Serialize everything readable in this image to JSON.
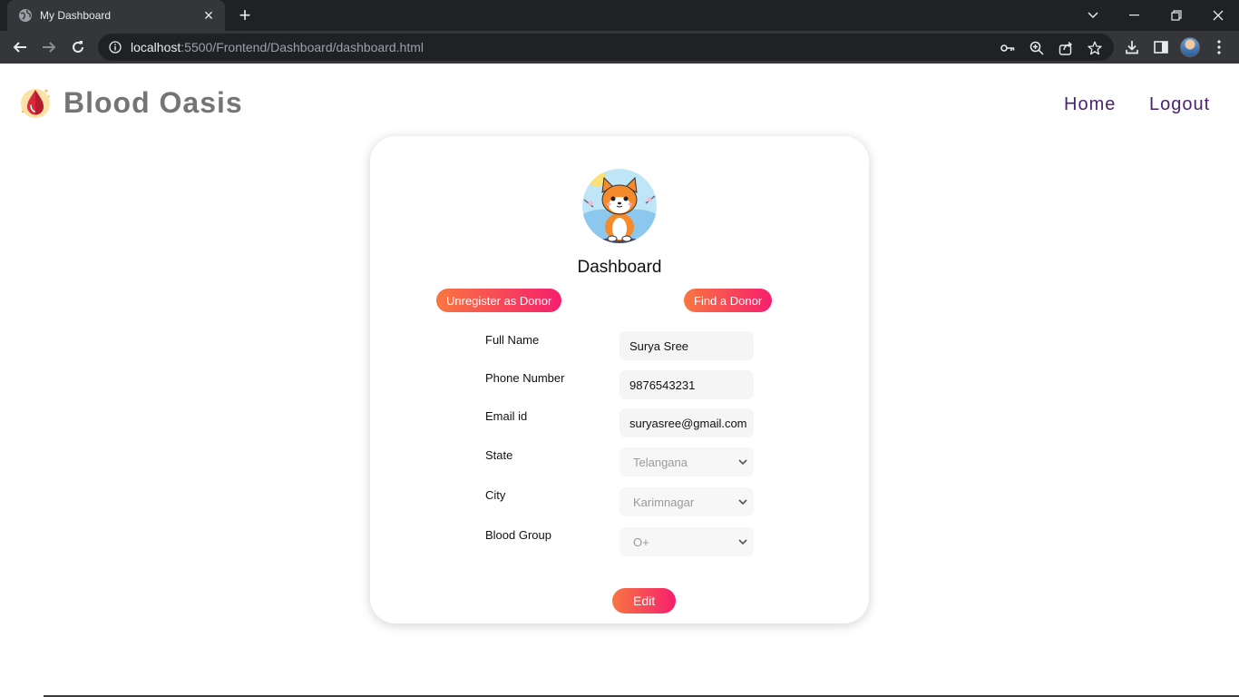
{
  "browser": {
    "tab_title": "My Dashboard",
    "url_host": "localhost",
    "url_rest": ":5500/Frontend/Dashboard/dashboard.html"
  },
  "header": {
    "brand": "Blood Oasis",
    "nav": [
      {
        "label": "Home"
      },
      {
        "label": "Logout"
      }
    ]
  },
  "card": {
    "title": "Dashboard",
    "unregister_label": "Unregister as Donor",
    "find_donor_label": "Find a Donor",
    "fields": [
      {
        "label": "Full Name",
        "value": "Surya Sree"
      },
      {
        "label": "Phone Number",
        "value": "9876543231"
      },
      {
        "label": "Email id",
        "value": "suryasree@gmail.com"
      },
      {
        "label": "State",
        "value": "Telangana"
      },
      {
        "label": "City",
        "value": "Karimnagar"
      },
      {
        "label": "Blood Group",
        "value": "O+"
      }
    ],
    "edit_label": "Edit"
  },
  "colors": {
    "button_gradient_start": "#f87641",
    "button_gradient_end": "#f51f6d",
    "nav_link": "#4a2370",
    "brand_text": "#757575"
  }
}
